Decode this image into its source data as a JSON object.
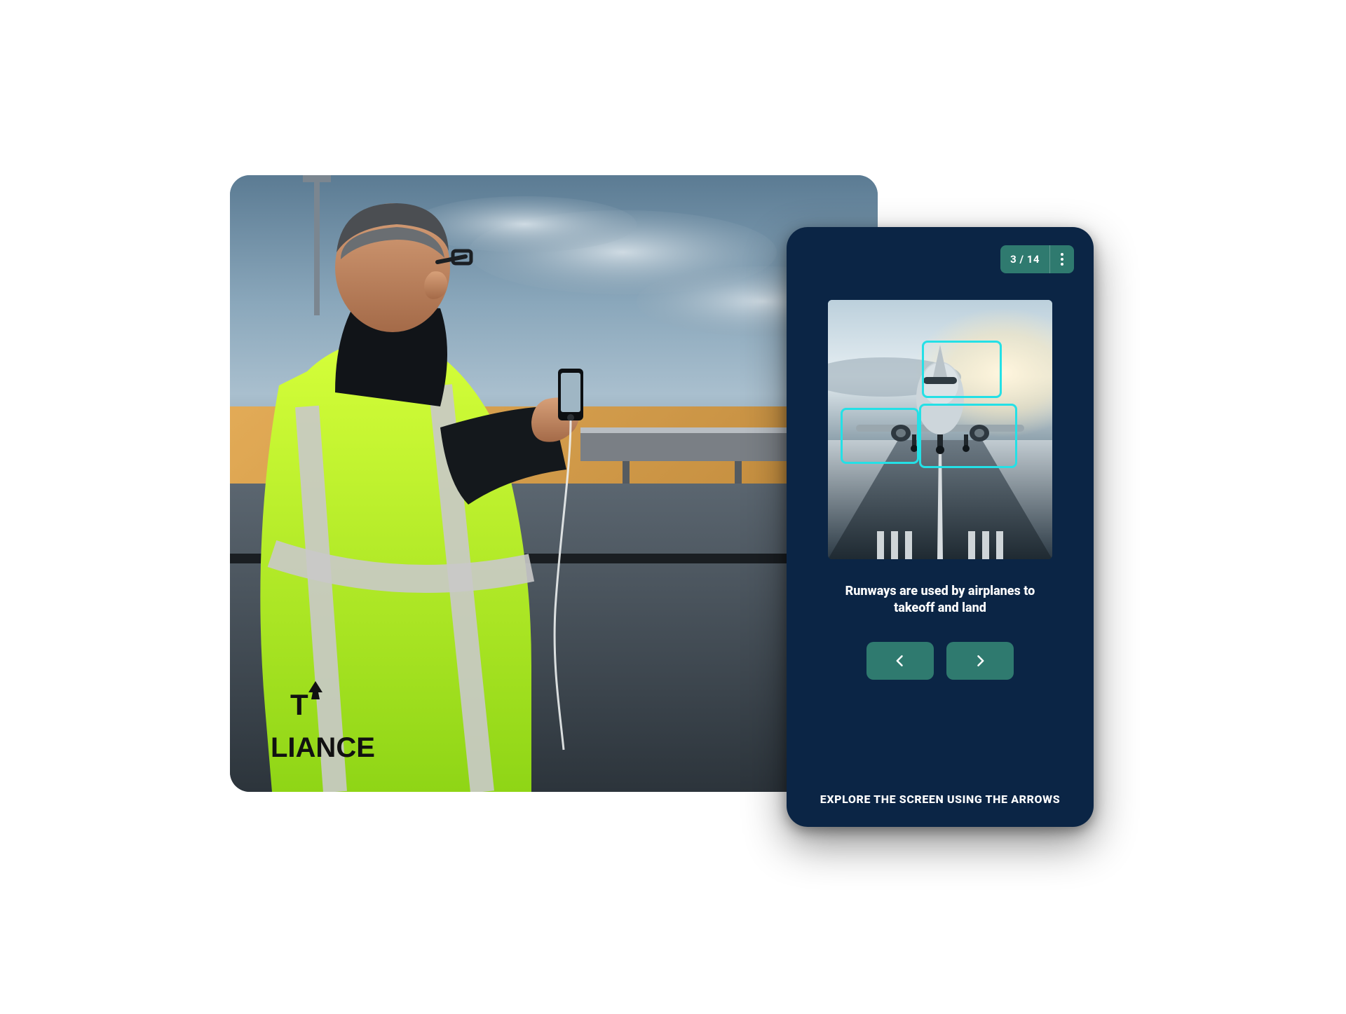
{
  "device": {
    "progress_label": "3 / 14",
    "caption": "Runways are used by airplanes to takeoff and land",
    "footer_hint": "EXPLORE THE SCREEN USING THE ARROWS",
    "hotspots": [
      "airplane-nose",
      "left-wing",
      "landing-gear"
    ],
    "colors": {
      "device_bg": "#0b2545",
      "accent": "#2f7a6f",
      "hotspot_border": "#24e0e6"
    }
  },
  "background_photo": {
    "description": "Man in high-visibility vest holding a smartphone, looking through an airport terminal window at the tarmac with a jet bridge.",
    "vest_text_lines": [
      "T",
      "LIANCE"
    ]
  }
}
